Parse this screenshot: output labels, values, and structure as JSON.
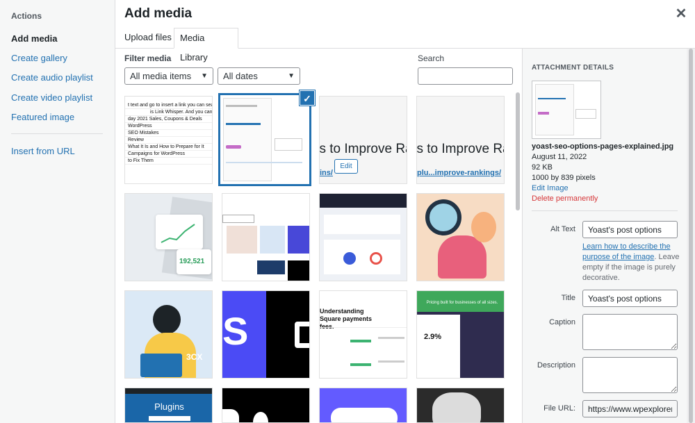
{
  "sidebar": {
    "heading": "Actions",
    "items": [
      {
        "label": "Add media"
      },
      {
        "label": "Create gallery"
      },
      {
        "label": "Create audio playlist"
      },
      {
        "label": "Create video playlist"
      },
      {
        "label": "Featured image"
      },
      {
        "label": "Insert from URL"
      }
    ]
  },
  "header": {
    "title": "Add media",
    "close_icon": "close-icon"
  },
  "tabs": [
    {
      "label": "Upload files"
    },
    {
      "label": "Media Library"
    }
  ],
  "filter": {
    "label": "Filter media",
    "type_value": "All media items",
    "date_value": "All dates"
  },
  "search": {
    "label": "Search",
    "placeholder": "",
    "value": ""
  },
  "tiles": {
    "t1_rows": [
      "t text and go to insert a link you can search",
      "is Link Whisper. And you can",
      "day 2021 Sales, Coupons & Deals",
      "WordPress",
      "SEO Mistakes",
      "Review",
      "What It Is and How to Prepare for It",
      "Campaigns for WordPress",
      "to Fix Them"
    ],
    "rank_text": "ss to Improve Ranki",
    "rank_link_a": "ins/",
    "rank_link_b": "plu...improve-rankings/",
    "edit_label": "Edit",
    "analytics_value": "192,521",
    "threecx_label": "3CX",
    "square_title": "Understanding Square payments fees.",
    "plugins_title": "Plugins",
    "pricing_title": "Pricing built for businesses of all sizes.",
    "pricing_value": "2.9%"
  },
  "details": {
    "heading": "ATTACHMENT DETAILS",
    "filename": "yoast-seo-options-pages-explained.jpg",
    "date": "August 11, 2022",
    "size": "92 KB",
    "dimensions": "1000 by 839 pixels",
    "edit_image": "Edit Image",
    "delete": "Delete permanently",
    "alt_label": "Alt Text",
    "alt_value": "Yoast's post options",
    "help_link": "Learn how to describe the purpose of the image",
    "help_rest": ". Leave empty if the image is purely decorative.",
    "title_label": "Title",
    "title_value": "Yoast's post options",
    "caption_label": "Caption",
    "description_label": "Description",
    "fileurl_label": "File URL:",
    "fileurl_value": "https://www.wpexplorer."
  },
  "colors": {
    "accent": "#2271b1",
    "danger": "#d63638",
    "sidebar_bg": "#f6f7f7"
  }
}
